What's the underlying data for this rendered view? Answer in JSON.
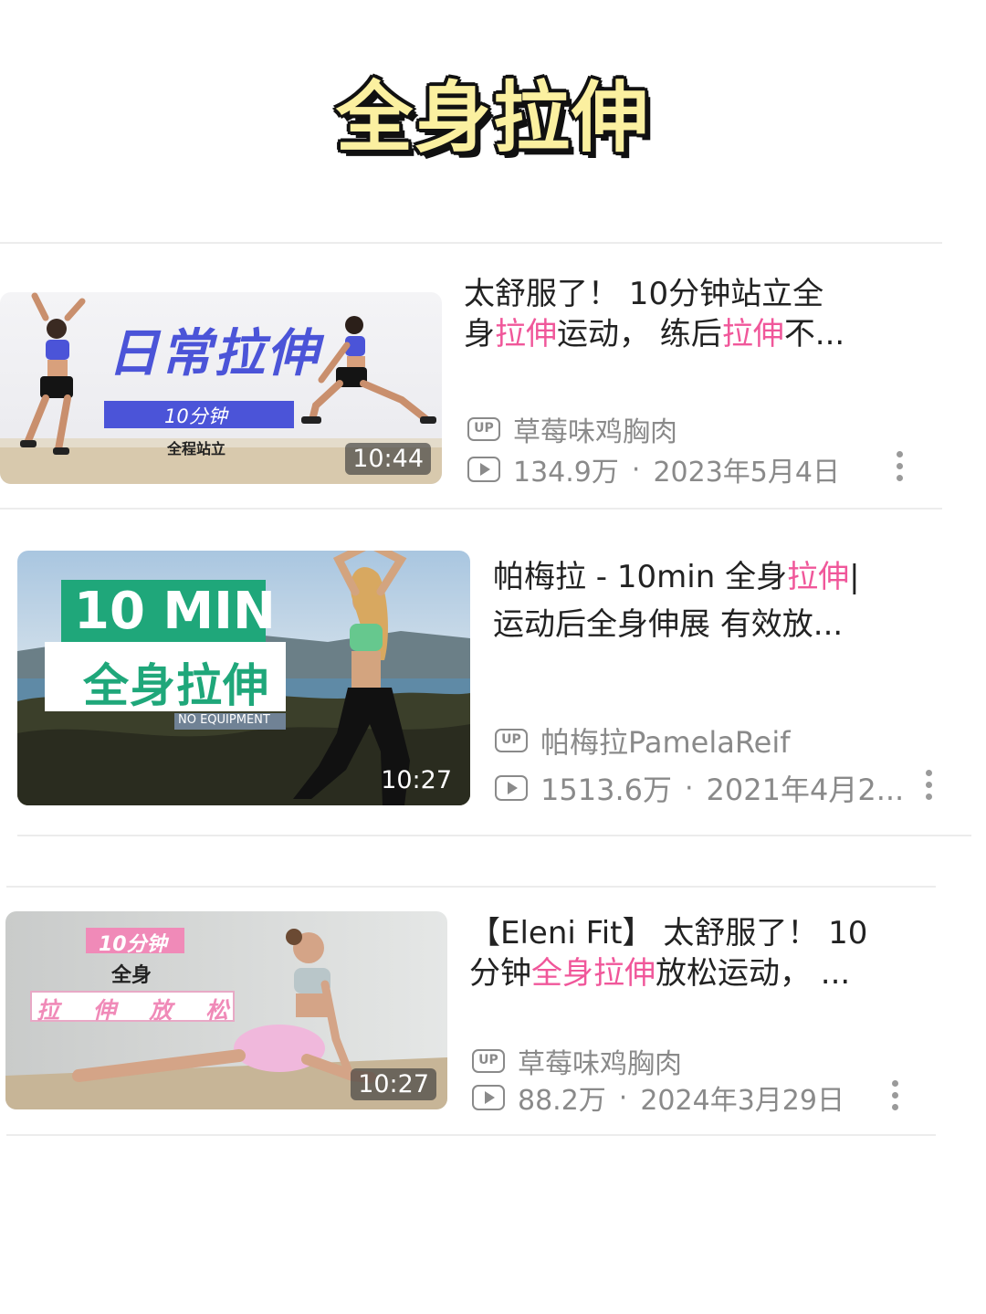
{
  "page_title": "全身拉伸",
  "videos": [
    {
      "title_line1": "太舒服了！ 10分钟站立全",
      "title_line2_parts": [
        "身",
        "拉伸",
        "运动， 练后",
        "拉伸",
        "不..."
      ],
      "uploader": "草莓味鸡胸肉",
      "views": "134.9万",
      "date": "2023年5月4日",
      "duration": "10:44",
      "thumb_text": {
        "main": "日常拉伸",
        "tag": "10分钟",
        "sub": "全程站立"
      }
    },
    {
      "title_line1_parts": [
        "帕梅拉 - 10min 全身",
        "拉伸",
        "|"
      ],
      "title_line2": "运动后全身伸展 有效放...",
      "uploader": "帕梅拉PamelaReif",
      "views": "1513.6万",
      "date": "2021年4月2...",
      "duration": "10:27",
      "thumb_text": {
        "main": "10 MIN",
        "sub": "全身拉伸",
        "tag": "NO EQUIPMENT"
      }
    },
    {
      "title_line1": "【Eleni Fit】 太舒服了！ 10",
      "title_line2_parts": [
        "分钟",
        "全身拉伸",
        "放松运动， ..."
      ],
      "uploader": "草莓味鸡胸肉",
      "views": "88.2万",
      "date": "2024年3月29日",
      "duration": "10:27",
      "thumb_text": {
        "tag": "10分钟",
        "main": "全身",
        "sub": "拉 伸 放 松"
      }
    }
  ],
  "labels": {
    "up": "UP",
    "sep": "·"
  },
  "colors": {
    "highlight": "#f0579a",
    "meta": "#8a8a8a",
    "title_fill": "#fbf0a0"
  }
}
